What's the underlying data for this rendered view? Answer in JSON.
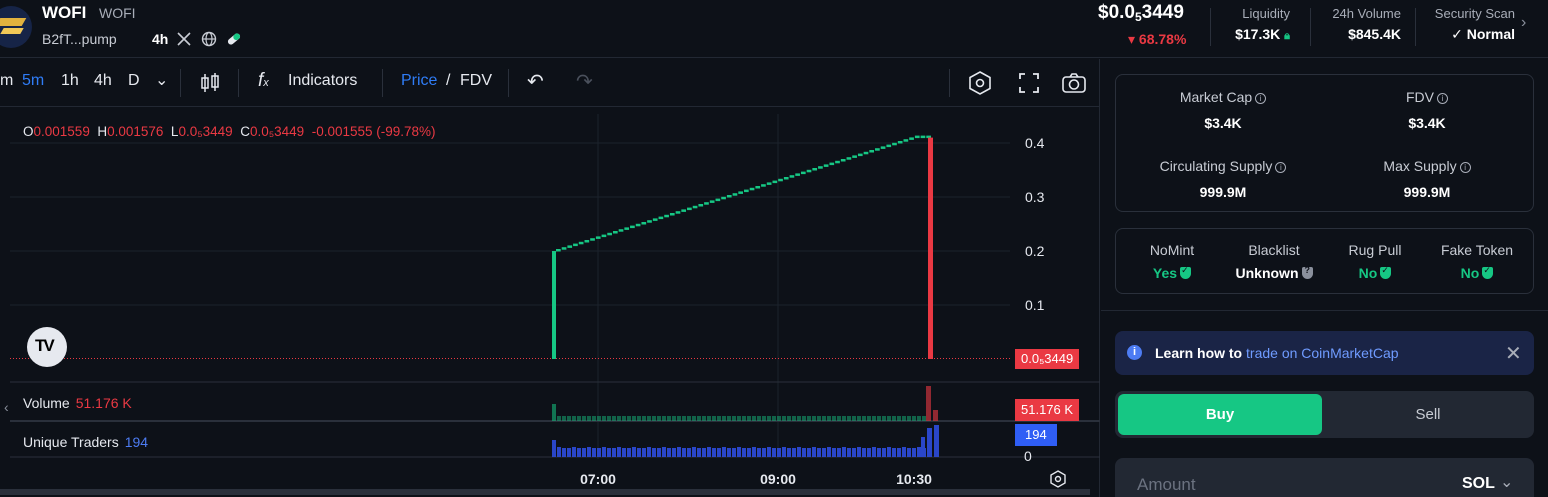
{
  "token": {
    "name": "WOFI",
    "symbol": "WOFI",
    "address": "B2fT...pump",
    "age": "4h"
  },
  "header": {
    "price_prefix": "$0.0",
    "price_sub": "5",
    "price_digits": "3449",
    "change": "68.78%",
    "liquidity_label": "Liquidity",
    "liquidity_value": "$17.3K",
    "volume_label": "24h Volume",
    "volume_value": "$845.4K",
    "security_label": "Security Scan",
    "security_value": "Normal"
  },
  "toolbar": {
    "intervals": [
      "m",
      "5m",
      "1h",
      "4h",
      "D"
    ],
    "active_interval": "5m",
    "indicators": "Indicators",
    "price_label": "Price",
    "fdv_label": "FDV"
  },
  "ohlc": {
    "o": "0.001559",
    "h": "0.001576",
    "l": "0.0₅3449",
    "c": "0.0₅3449",
    "change": "-0.001555 (-99.78%)"
  },
  "panes": {
    "volume_label": "Volume",
    "volume_value": "51.176 K",
    "traders_label": "Unique Traders",
    "traders_value": "194",
    "price_badge": "0.0₅3449",
    "volume_badge": "51.176 K",
    "traders_badge": "194",
    "bottom_axis": "0"
  },
  "chart_data": {
    "type": "line",
    "y_ticks": [
      "0.4",
      "0.3",
      "0.2",
      "0.1"
    ],
    "x_ticks": [
      "07:00",
      "09:00",
      "10:30"
    ],
    "series": [
      {
        "values": [
          0.2,
          0.21,
          0.22,
          0.23,
          0.24,
          0.25,
          0.26,
          0.27,
          0.28,
          0.29,
          0.3,
          0.31,
          0.32,
          0.33,
          0.34,
          0.35,
          0.36,
          0.37,
          0.38,
          0.39,
          0.4,
          0.41,
          0.0
        ]
      }
    ],
    "colors": {
      "up": "#16c784",
      "down": "#ea3943",
      "traders": "#2a46c9"
    }
  },
  "metrics": {
    "market_cap_label": "Market Cap",
    "market_cap_value": "$3.4K",
    "fdv_label": "FDV",
    "fdv_value": "$3.4K",
    "circ_label": "Circulating Supply",
    "circ_value": "999.9M",
    "max_label": "Max Supply",
    "max_value": "999.9M"
  },
  "security": [
    {
      "label": "NoMint",
      "value": "Yes"
    },
    {
      "label": "Blacklist",
      "value": "Unknown"
    },
    {
      "label": "Rug Pull",
      "value": "No"
    },
    {
      "label": "Fake Token",
      "value": "No"
    }
  ],
  "banner": {
    "text": "Learn how to",
    "link": "trade on CoinMarketCap"
  },
  "trade": {
    "buy": "Buy",
    "sell": "Sell",
    "amount_placeholder": "Amount",
    "currency": "SOL"
  }
}
